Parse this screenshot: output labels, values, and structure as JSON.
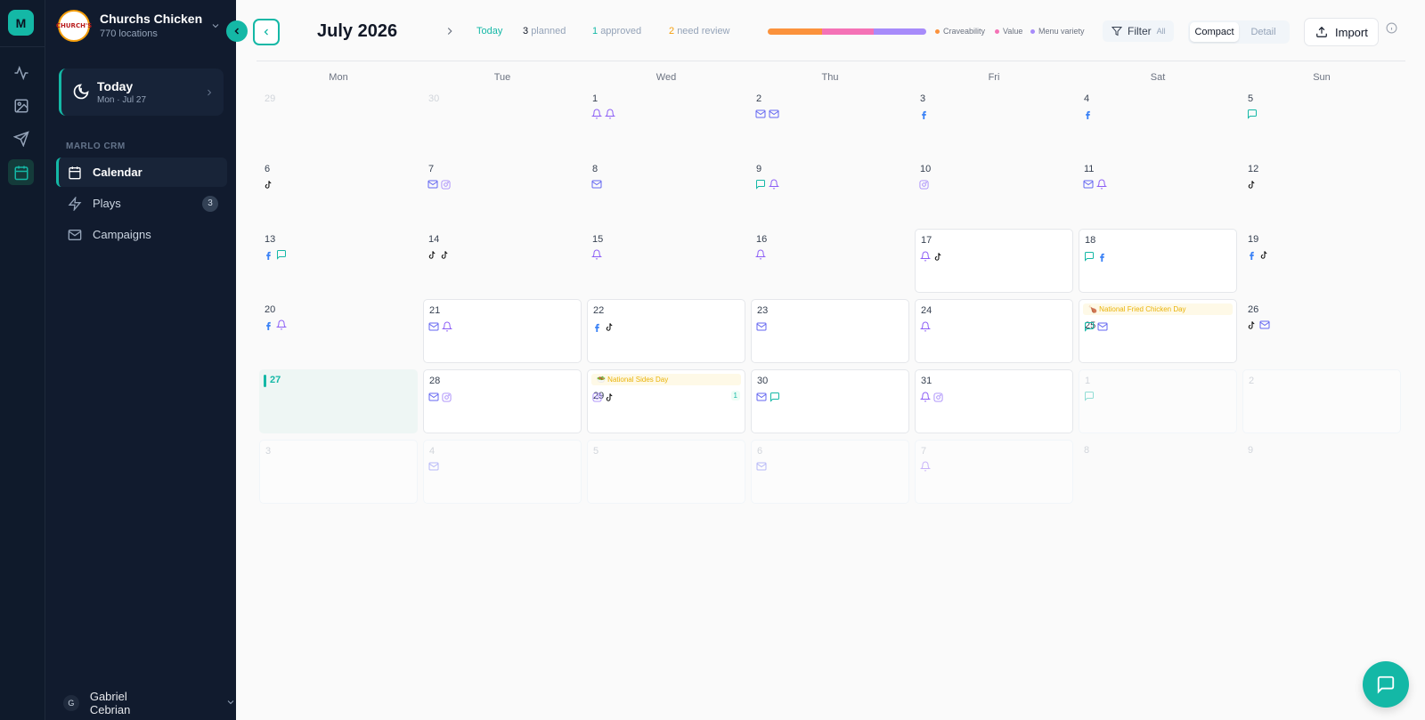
{
  "rail": {
    "logo_letter": "M"
  },
  "brand": {
    "logo_text": "CHURCH'S",
    "name": "Churchs Chicken",
    "sub": "770 locations"
  },
  "today_card": {
    "title": "Today",
    "date": "Mon · Jul 27"
  },
  "section_label": "MARLO CRM",
  "nav": [
    {
      "id": "calendar",
      "label": "Calendar",
      "icon": "calendar-icon",
      "active": true
    },
    {
      "id": "plays",
      "label": "Plays",
      "icon": "lightning-icon",
      "badge": "3"
    },
    {
      "id": "campaigns",
      "label": "Campaigns",
      "icon": "mail-icon"
    }
  ],
  "user": {
    "initial": "G",
    "name": "Gabriel Cebrian"
  },
  "header": {
    "month": "July 2026",
    "today_label": "Today",
    "planned_num": "3",
    "planned_label": "planned",
    "approved_num": "1",
    "approved_label": "approved",
    "review_num": "2",
    "review_label": "need review",
    "bar": [
      {
        "color": "#fb923c",
        "share": 0.34
      },
      {
        "color": "#f472b6",
        "share": 0.33
      },
      {
        "color": "#a78bfa",
        "share": 0.33
      }
    ],
    "legend": [
      {
        "label": "Craveability",
        "color": "#fb923c"
      },
      {
        "label": "Value",
        "color": "#f472b6"
      },
      {
        "label": "Menu variety",
        "color": "#a78bfa"
      }
    ],
    "filter_label": "Filter",
    "filter_value": "All",
    "view_compact": "Compact",
    "view_detail": "Detail",
    "import_label": "Import"
  },
  "weekdays": [
    "Mon",
    "Tue",
    "Wed",
    "Thu",
    "Fri",
    "Sat",
    "Sun"
  ],
  "colors": {
    "accent": "#14b8a6",
    "fb": "#3b82f6",
    "mail": "#6366f1",
    "bell": "#8b5cf6",
    "chat": "#14b8a6",
    "ig": "#a78bfa",
    "tiktok": "#111111"
  },
  "weeks": [
    [
      {
        "d": "29",
        "m": 1
      },
      {
        "d": "30",
        "m": 1
      },
      {
        "d": "1",
        "i": [
          "bell",
          "bell"
        ]
      },
      {
        "d": "2",
        "i": [
          "mail",
          "mail"
        ]
      },
      {
        "d": "3",
        "i": [
          "fb"
        ]
      },
      {
        "d": "4",
        "i": [
          "fb"
        ]
      },
      {
        "d": "5",
        "i": [
          "chat"
        ]
      }
    ],
    [
      {
        "d": "6",
        "i": [
          "tiktok"
        ]
      },
      {
        "d": "7",
        "i": [
          "mail",
          "ig"
        ]
      },
      {
        "d": "8",
        "i": [
          "mail"
        ]
      },
      {
        "d": "9",
        "i": [
          "chat",
          "bell"
        ]
      },
      {
        "d": "10",
        "i": [
          "ig"
        ]
      },
      {
        "d": "11",
        "i": [
          "mail",
          "bell"
        ]
      },
      {
        "d": "12",
        "i": [
          "tiktok"
        ]
      }
    ],
    [
      {
        "d": "13",
        "i": [
          "fb",
          "chat"
        ]
      },
      {
        "d": "14",
        "i": [
          "tiktok",
          "tiktok"
        ]
      },
      {
        "d": "15",
        "i": [
          "bell"
        ]
      },
      {
        "d": "16",
        "i": [
          "bell"
        ]
      },
      {
        "d": "17",
        "i": [
          "bell",
          "tiktok"
        ],
        "b": 1
      },
      {
        "d": "18",
        "i": [
          "chat",
          "fb"
        ],
        "b": 1
      },
      {
        "d": "19",
        "i": [
          "fb",
          "tiktok"
        ]
      }
    ],
    [
      {
        "d": "20",
        "i": [
          "fb",
          "bell"
        ]
      },
      {
        "d": "21",
        "i": [
          "mail",
          "bell"
        ],
        "b": 1
      },
      {
        "d": "22",
        "i": [
          "fb",
          "tiktok"
        ],
        "b": 1
      },
      {
        "d": "23",
        "i": [
          "mail"
        ],
        "b": 1
      },
      {
        "d": "24",
        "i": [
          "bell"
        ],
        "b": 1
      },
      {
        "d": "25",
        "i": [
          "chat",
          "mail"
        ],
        "b": 1,
        "e": "🍗 National Fried Chicken Day"
      },
      {
        "d": "26",
        "i": [
          "tiktok",
          "mail"
        ]
      }
    ],
    [
      {
        "d": "27",
        "t": 1
      },
      {
        "d": "28",
        "i": [
          "mail",
          "ig"
        ],
        "b": 1
      },
      {
        "d": "29",
        "i": [
          "ig",
          "tiktok"
        ],
        "b": 1,
        "e": "🥗 National Sides Day",
        "c": "1"
      },
      {
        "d": "30",
        "i": [
          "mail",
          "chat"
        ],
        "b": 1
      },
      {
        "d": "31",
        "i": [
          "bell",
          "ig"
        ],
        "b": 1
      },
      {
        "d": "1",
        "i": [
          "chat"
        ],
        "m": 1,
        "g": 1
      },
      {
        "d": "2",
        "m": 1,
        "g": 1
      }
    ],
    [
      {
        "d": "3",
        "m": 1,
        "g": 1
      },
      {
        "d": "4",
        "i": [
          "mail"
        ],
        "m": 1,
        "g": 1
      },
      {
        "d": "5",
        "m": 1,
        "g": 1
      },
      {
        "d": "6",
        "i": [
          "mail"
        ],
        "m": 1,
        "g": 1
      },
      {
        "d": "7",
        "i": [
          "bell"
        ],
        "m": 1,
        "g": 1
      },
      {
        "d": "8",
        "m": 1
      },
      {
        "d": "9",
        "m": 1
      }
    ]
  ]
}
